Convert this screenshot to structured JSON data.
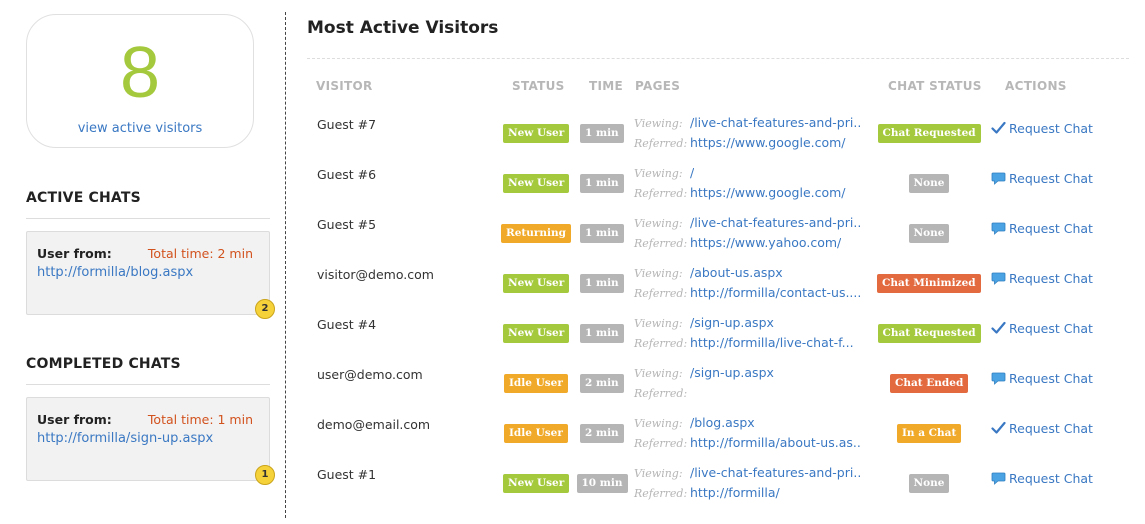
{
  "sidebar": {
    "visitor_count": "8",
    "view_link": "view active visitors",
    "active_chats": {
      "title": "ACTIVE CHATS",
      "from_label": "User from:",
      "total_time": "Total time: 2 min",
      "url": "http://formilla/blog.aspx",
      "badge": "2"
    },
    "completed_chats": {
      "title": "COMPLETED CHATS",
      "from_label": "User from:",
      "total_time": "Total time: 1 min",
      "url": "http://formilla/sign-up.aspx",
      "badge": "1"
    }
  },
  "main": {
    "title": "Most Active Visitors",
    "headers": {
      "visitor": "VISITOR",
      "status": "STATUS",
      "time": "TIME",
      "pages": "PAGES",
      "chat_status": "CHAT STATUS",
      "actions": "ACTIONS"
    },
    "viewing_label": "Viewing:",
    "referred_label": "Referred:",
    "rows": [
      {
        "visitor": "Guest #7",
        "status": "New User",
        "status_color": "#a5c93d",
        "time": "1 min",
        "viewing": "/live-chat-features-and-pri...",
        "referred": "https://www.google.com/",
        "chat_status": "Chat Requested",
        "chat_color": "#a5c93d",
        "action": "Request Chat",
        "action_icon": "check-icon"
      },
      {
        "visitor": "Guest #6",
        "status": "New User",
        "status_color": "#a5c93d",
        "time": "1 min",
        "viewing": "/",
        "referred": "https://www.google.com/",
        "chat_status": "None",
        "chat_color": "#b5b5b5",
        "action": "Request Chat",
        "action_icon": "chat-bubble-icon"
      },
      {
        "visitor": "Guest #5",
        "status": "Returning",
        "status_color": "#f0a928",
        "time": "1 min",
        "viewing": "/live-chat-features-and-pri...",
        "referred": "https://www.yahoo.com/",
        "chat_status": "None",
        "chat_color": "#b5b5b5",
        "action": "Request Chat",
        "action_icon": "chat-bubble-icon"
      },
      {
        "visitor": "visitor@demo.com",
        "status": "New User",
        "status_color": "#a5c93d",
        "time": "1 min",
        "viewing": "/about-us.aspx",
        "referred": "http://formilla/contact-us....",
        "chat_status": "Chat Minimized",
        "chat_color": "#e26a3e",
        "action": "Request Chat",
        "action_icon": "chat-bubble-icon"
      },
      {
        "visitor": "Guest #4",
        "status": "New User",
        "status_color": "#a5c93d",
        "time": "1 min",
        "viewing": "/sign-up.aspx",
        "referred": "http://formilla/live-chat-f...",
        "chat_status": "Chat Requested",
        "chat_color": "#a5c93d",
        "action": "Request Chat",
        "action_icon": "check-icon"
      },
      {
        "visitor": "user@demo.com",
        "status": "Idle User",
        "status_color": "#f0a928",
        "time": "2 min",
        "viewing": "/sign-up.aspx",
        "referred": "",
        "chat_status": "Chat Ended",
        "chat_color": "#e26a3e",
        "action": "Request Chat",
        "action_icon": "chat-bubble-icon"
      },
      {
        "visitor": "demo@email.com",
        "status": "Idle User",
        "status_color": "#f0a928",
        "time": "2 min",
        "viewing": "/blog.aspx",
        "referred": "http://formilla/about-us.as...",
        "chat_status": "In a Chat",
        "chat_color": "#f0a928",
        "action": "Request Chat",
        "action_icon": "check-icon"
      },
      {
        "visitor": "Guest #1",
        "status": "New User",
        "status_color": "#a5c93d",
        "time": "10 min",
        "viewing": "/live-chat-features-and-pri...",
        "referred": "http://formilla/",
        "chat_status": "None",
        "chat_color": "#b5b5b5",
        "action": "Request Chat",
        "action_icon": "chat-bubble-icon"
      }
    ]
  }
}
